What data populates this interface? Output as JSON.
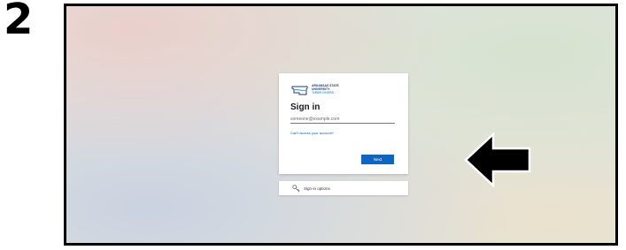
{
  "step": {
    "number": "2"
  },
  "signin": {
    "logo": {
      "line1": "Arkansas State",
      "line2": "University",
      "line3": "Three Rivers"
    },
    "title": "Sign in",
    "email_placeholder": "someone@example.com",
    "cant_access_link": "Can't access your account?",
    "next_label": "Next"
  },
  "options": {
    "label": "Sign-in options",
    "icon": "key-icon"
  },
  "annotation": {
    "arrow_icon": "left-arrow-icon",
    "arrow_color": "#000000"
  },
  "colors": {
    "primary_button": "#0f66c2",
    "link": "#0b5fb8"
  }
}
